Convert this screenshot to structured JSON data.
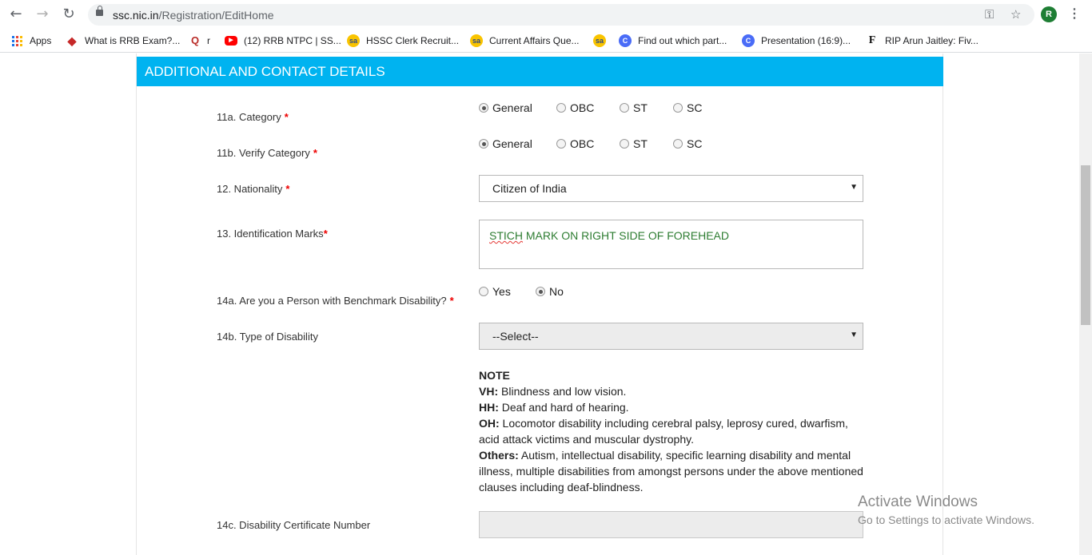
{
  "browser": {
    "url_domain": "ssc.nic.in",
    "url_path": "/Registration/EditHome",
    "avatar_initial": "R"
  },
  "bookmarks": [
    {
      "label": "Apps",
      "icon": "apps-grid-icon"
    },
    {
      "label": "What is RRB Exam?...",
      "icon": "diamond-icon",
      "color": "#c62828"
    },
    {
      "label": "r",
      "icon": "quora-icon",
      "color": "#b92b27"
    },
    {
      "label": "(12) RRB NTPC | SS...",
      "icon": "youtube-icon",
      "color": "#ff0000"
    },
    {
      "label": "HSSC Clerk Recruit...",
      "icon": "sa-icon",
      "color": "#f9c400"
    },
    {
      "label": "Current Affairs Que...",
      "icon": "sa-icon",
      "color": "#f9c400"
    },
    {
      "label": "",
      "icon": "sa-icon",
      "color": "#f9c400"
    },
    {
      "label": "Find out which part...",
      "icon": "c-icon",
      "color": "#4a6cf7"
    },
    {
      "label": "Presentation (16:9)...",
      "icon": "c-icon",
      "color": "#4a6cf7"
    },
    {
      "label": "RIP Arun Jaitley: Fiv...",
      "icon": "f-icon",
      "color": "#111111"
    }
  ],
  "section": {
    "title": "ADDITIONAL AND CONTACT DETAILS",
    "header_color": "#00b3f0"
  },
  "fields": {
    "category": {
      "label": "11a. Category",
      "options": [
        "General",
        "OBC",
        "ST",
        "SC"
      ],
      "selected": "General"
    },
    "verify_category": {
      "label": "11b. Verify Category",
      "options": [
        "General",
        "OBC",
        "ST",
        "SC"
      ],
      "selected": "General"
    },
    "nationality": {
      "label": "12. Nationality",
      "value": "Citizen of India"
    },
    "identification_marks": {
      "label": "13. Identification Marks",
      "value_word1": "STICH",
      "value_rest": " MARK ON RIGHT SIDE OF FOREHEAD"
    },
    "benchmark_disability": {
      "label": "14a. Are you a Person with Benchmark Disability?",
      "options": [
        "Yes",
        "No"
      ],
      "selected": "No"
    },
    "disability_type": {
      "label": "14b. Type of Disability",
      "value": "--Select--"
    },
    "disability_certificate": {
      "label": "14c. Disability Certificate Number",
      "value": ""
    }
  },
  "note": {
    "heading": "NOTE",
    "vh_key": "VH:",
    "vh_text": " Blindness and low vision.",
    "hh_key": "HH:",
    "hh_text": " Deaf and hard of hearing.",
    "oh_key": "OH:",
    "oh_text": " Locomotor disability including cerebral palsy, leprosy cured, dwarfism, acid attack victims and muscular dystrophy.",
    "others_key": "Others:",
    "others_text": " Autism, intellectual disability, specific learning disability and mental illness, multiple disabilities from amongst persons under the above mentioned clauses including deaf-blindness."
  },
  "watermark": {
    "line1": "Activate Windows",
    "line2": "Go to Settings to activate Windows."
  }
}
